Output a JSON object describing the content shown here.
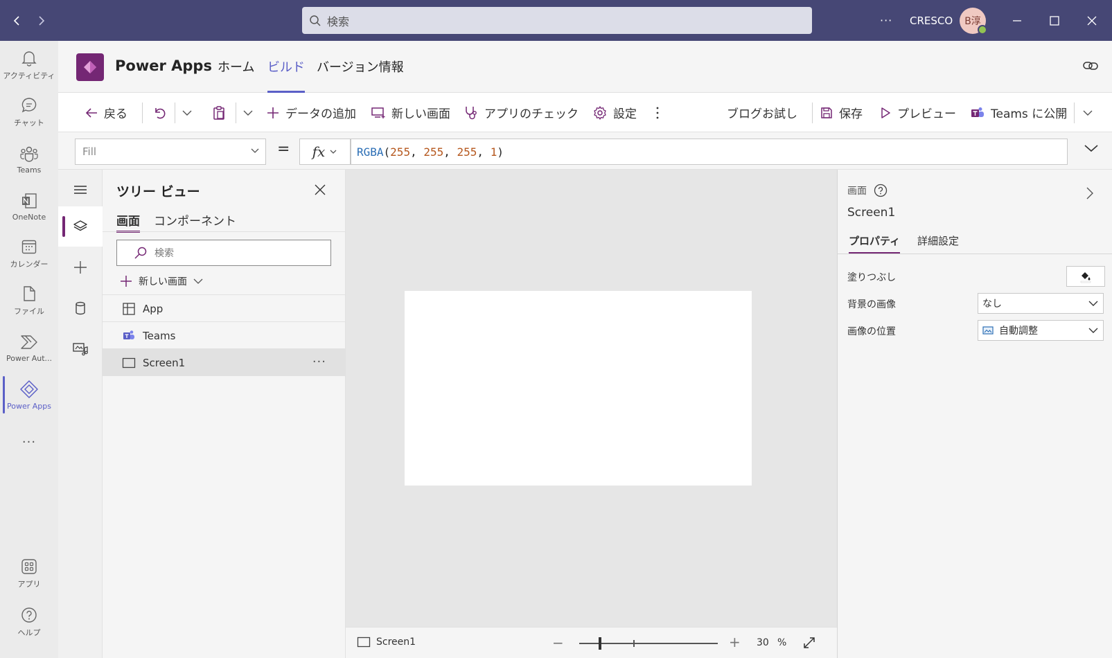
{
  "titlebar": {
    "search_placeholder": "検索",
    "more": "···",
    "org": "CRESCO",
    "avatar_initials": "B淳"
  },
  "rail": [
    {
      "label": "アクティビティ",
      "icon": "bell-icon"
    },
    {
      "label": "チャット",
      "icon": "chat-icon"
    },
    {
      "label": "Teams",
      "icon": "teams-icon"
    },
    {
      "label": "OneNote",
      "icon": "onenote-icon"
    },
    {
      "label": "カレンダー",
      "icon": "calendar-icon"
    },
    {
      "label": "ファイル",
      "icon": "file-icon"
    },
    {
      "label": "Power Aut...",
      "icon": "power-automate-icon"
    },
    {
      "label": "Power Apps",
      "icon": "power-apps-icon"
    }
  ],
  "rail_more": "···",
  "rail_bottom": [
    {
      "label": "アプリ",
      "icon": "apps-icon"
    },
    {
      "label": "ヘルプ",
      "icon": "help-icon"
    }
  ],
  "app": {
    "title": "Power Apps",
    "tabs": [
      "ホーム",
      "ビルド",
      "バージョン情報"
    ],
    "active_tab": "ビルド"
  },
  "commands": {
    "back": "戻る",
    "add_data": "データの追加",
    "new_screen": "新しい画面",
    "app_checker": "アプリのチェック",
    "settings": "設定",
    "blog": "ブログお試し",
    "save": "保存",
    "preview": "プレビュー",
    "publish": "Teams に公開"
  },
  "formula": {
    "property": "Fill",
    "equals": "=",
    "fx": "fx",
    "fn": "RGBA",
    "open": "(",
    "r": "255",
    "g": "255",
    "b": "255",
    "a": "1",
    "sep": ", ",
    "close": ")"
  },
  "tree": {
    "title": "ツリー ビュー",
    "tabs": [
      "画面",
      "コンポーネント"
    ],
    "search_placeholder": "検索",
    "new_screen": "新しい画面",
    "items": [
      {
        "label": "App",
        "icon": "app-icon"
      },
      {
        "label": "Teams",
        "icon": "teams-icon"
      },
      {
        "label": "Screen1",
        "icon": "screen-icon",
        "selected": true
      }
    ],
    "more": "···"
  },
  "status": {
    "screen": "Screen1",
    "zoom_value": "30",
    "zoom_unit": "%",
    "zoom_level": 0.3
  },
  "properties": {
    "type": "画面",
    "name": "Screen1",
    "tabs": [
      "プロパティ",
      "詳細設定"
    ],
    "fill_label": "塗りつぶし",
    "fill_color": "#ffffff",
    "bg_image_label": "背景の画像",
    "bg_image_value": "なし",
    "image_position_label": "画像の位置",
    "image_position_value": "自動調整"
  },
  "colors": {
    "titlebar": "#464775",
    "teams_accent": "#5b5fc7",
    "powerapps_accent": "#742774"
  }
}
